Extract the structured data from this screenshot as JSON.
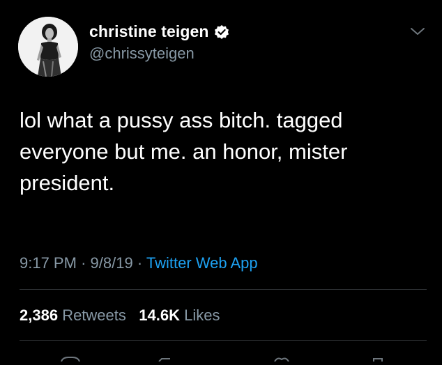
{
  "tweet": {
    "display_name": "christine teigen",
    "handle": "@chrissyteigen",
    "text_lines": [
      "lol what a pussy ass bitch. tagged",
      "everyone but me. an honor, mister",
      "president."
    ],
    "time": "9:17 PM",
    "date": "9/8/19",
    "separator": "·",
    "source": "Twitter Web App",
    "retweets_count": "2,386",
    "retweets_label": "Retweets",
    "likes_count": "14.6K",
    "likes_label": "Likes"
  },
  "icons": {
    "verified": "verified-badge-icon",
    "caret": "chevron-down-icon"
  },
  "colors": {
    "background": "#000000",
    "text": "#ffffff",
    "secondary": "#8899a6",
    "link": "#1da1f2",
    "divider": "#2f3336"
  }
}
